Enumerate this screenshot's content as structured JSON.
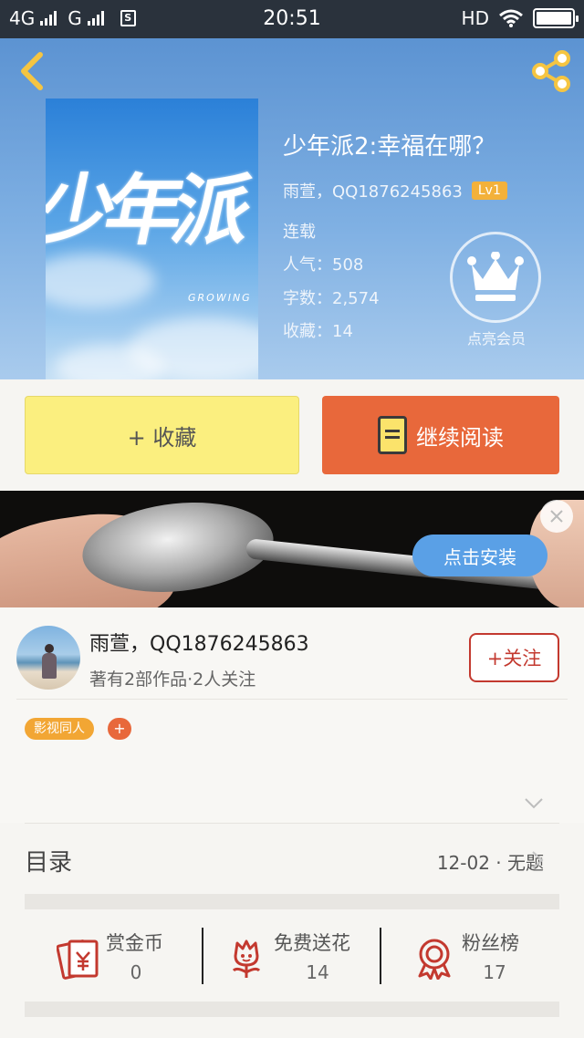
{
  "status_bar": {
    "network_left": "4G",
    "network_right": "G",
    "sim_badge": "S",
    "time": "20:51",
    "hd": "HD"
  },
  "book": {
    "cover_title": "少年派",
    "cover_subtitle": "GROWING",
    "title": "少年派2:幸福在哪？",
    "author": "雨萱，QQ1876245863",
    "level": "Lv1",
    "status": "连载",
    "popularity": "人气：508",
    "word_count": "字数：2,574",
    "favorites": "收藏：14"
  },
  "vip": {
    "label": "点亮会员"
  },
  "actions": {
    "collect_label": "+ 收藏",
    "read_label": "继续阅读"
  },
  "ad": {
    "install_label": "点击安装"
  },
  "author_card": {
    "name": "雨萱，QQ1876245863",
    "info": "著有2部作品·2人关注",
    "follow_label": "+关注",
    "tag": "影视同人",
    "tag_add": "+"
  },
  "catalog": {
    "title": "目录",
    "latest": "12-02 · 无题"
  },
  "stats": [
    {
      "label": "赏金币",
      "count": "0",
      "icon": "red-envelope-yen-icon"
    },
    {
      "label": "免费送花",
      "count": "14",
      "icon": "flower-icon"
    },
    {
      "label": "粉丝榜",
      "count": "17",
      "icon": "medal-icon"
    }
  ],
  "colors": {
    "accent_orange": "#e8683b",
    "collect_yellow": "#fbef7f",
    "follow_red": "#c3392f",
    "tag_orange": "#f2a634",
    "lv_badge": "#f3b13a"
  }
}
